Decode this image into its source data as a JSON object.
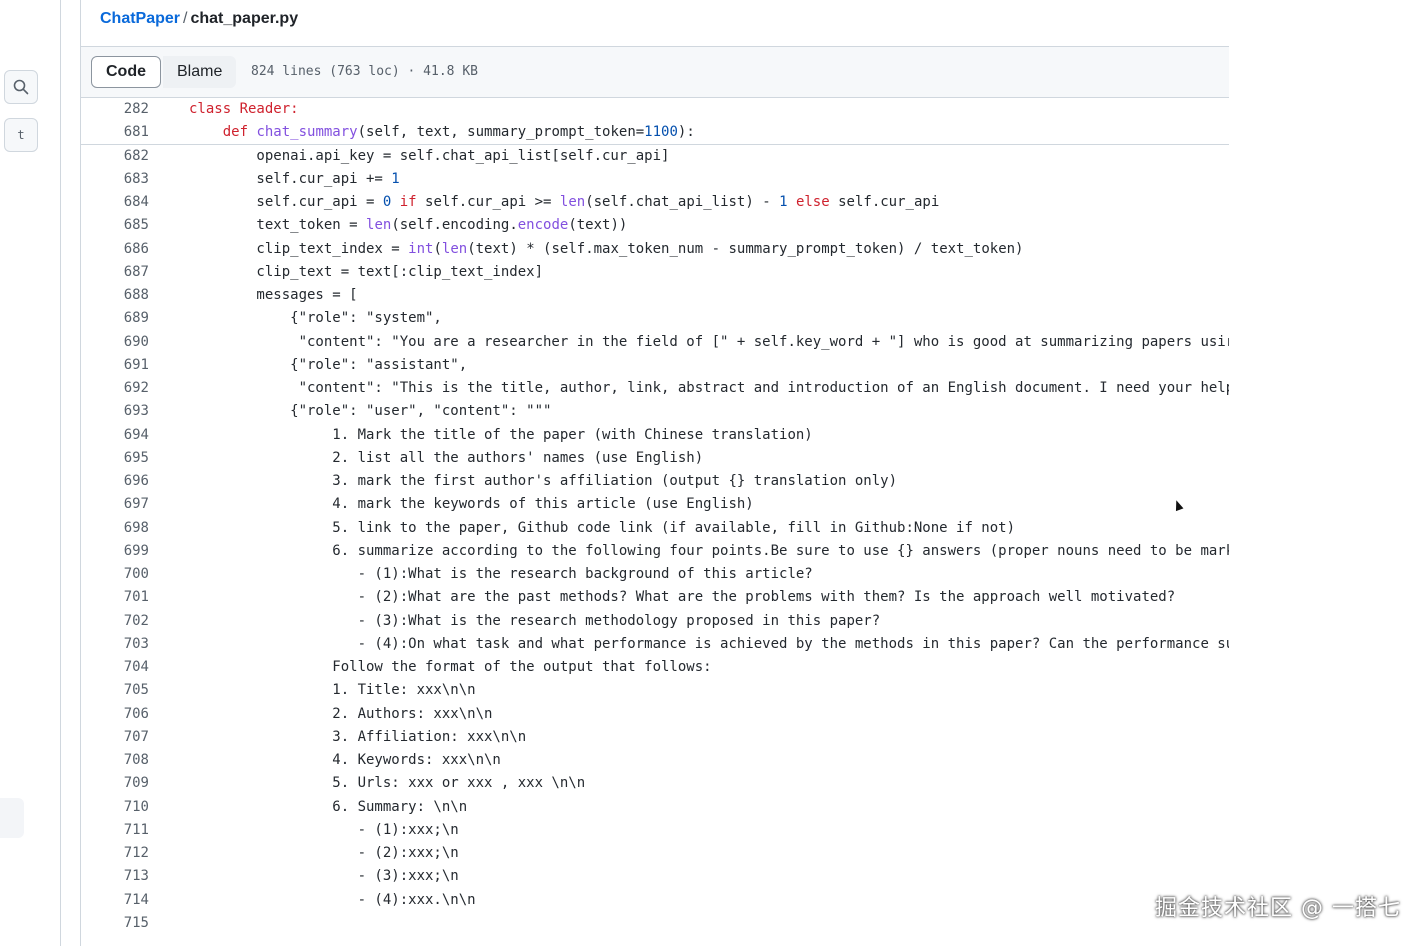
{
  "rail": {
    "search_icon": "search-icon",
    "t_button_label": "t"
  },
  "breadcrumb": {
    "repo": "ChatPaper",
    "separator": "/",
    "file": "chat_paper.py"
  },
  "tabs": {
    "code": "Code",
    "blame": "Blame"
  },
  "file_meta": "824 lines (763 loc) · 41.8 KB",
  "lines": [
    {
      "n": "282",
      "segments": [
        {
          "t": "class Reader:",
          "c": "kw"
        }
      ]
    },
    {
      "n": "681",
      "segments": [
        {
          "t": "    "
        },
        {
          "t": "def ",
          "c": "kw"
        },
        {
          "t": "chat_summary",
          "c": "fn"
        },
        {
          "t": "(self, text, summary_prompt_token="
        },
        {
          "t": "1100",
          "c": "num"
        },
        {
          "t": "):"
        }
      ]
    },
    {
      "n": "682",
      "segments": [
        {
          "t": "        openai.api_key = self.chat_api_list[self.cur_api]"
        }
      ]
    },
    {
      "n": "683",
      "segments": [
        {
          "t": "        self.cur_api += "
        },
        {
          "t": "1",
          "c": "num"
        }
      ]
    },
    {
      "n": "684",
      "segments": [
        {
          "t": "        self.cur_api = "
        },
        {
          "t": "0",
          "c": "num"
        },
        {
          "t": " "
        },
        {
          "t": "if",
          "c": "kw"
        },
        {
          "t": " self.cur_api >= "
        },
        {
          "t": "len",
          "c": "fn"
        },
        {
          "t": "(self.chat_api_list) - "
        },
        {
          "t": "1",
          "c": "num"
        },
        {
          "t": " "
        },
        {
          "t": "else",
          "c": "kw"
        },
        {
          "t": " self.cur_api"
        }
      ]
    },
    {
      "n": "685",
      "segments": [
        {
          "t": "        text_token = "
        },
        {
          "t": "len",
          "c": "fn"
        },
        {
          "t": "(self.encoding."
        },
        {
          "t": "encode",
          "c": "fn"
        },
        {
          "t": "(text))"
        }
      ]
    },
    {
      "n": "686",
      "segments": [
        {
          "t": "        clip_text_index = "
        },
        {
          "t": "int",
          "c": "fn"
        },
        {
          "t": "("
        },
        {
          "t": "len",
          "c": "fn"
        },
        {
          "t": "(text) * (self.max_token_num - summary_prompt_token) / text_token)"
        }
      ]
    },
    {
      "n": "687",
      "segments": [
        {
          "t": "        clip_text = text[:clip_text_index]"
        }
      ]
    },
    {
      "n": "688",
      "segments": [
        {
          "t": "        messages = ["
        }
      ]
    },
    {
      "n": "689",
      "segments": [
        {
          "t": "            {\"role\": \"system\","
        }
      ]
    },
    {
      "n": "690",
      "segments": [
        {
          "t": "             \"content\": \"You are a researcher in the field of [\" + self.key_word + \"] who is good at summarizing papers usir"
        }
      ]
    },
    {
      "n": "691",
      "segments": [
        {
          "t": "            {\"role\": \"assistant\","
        }
      ]
    },
    {
      "n": "692",
      "segments": [
        {
          "t": "             \"content\": \"This is the title, author, link, abstract and introduction of an English document. I need your help"
        }
      ]
    },
    {
      "n": "693",
      "segments": [
        {
          "t": "            {\"role\": \"user\", \"content\": \"\"\""
        }
      ]
    },
    {
      "n": "694",
      "segments": [
        {
          "t": "                 1. Mark the title of the paper (with Chinese translation)"
        }
      ]
    },
    {
      "n": "695",
      "segments": [
        {
          "t": "                 2. list all the authors' names (use English)"
        }
      ]
    },
    {
      "n": "696",
      "segments": [
        {
          "t": "                 3. mark the first author's affiliation (output {} translation only)"
        }
      ]
    },
    {
      "n": "697",
      "segments": [
        {
          "t": "                 4. mark the keywords of this article (use English)"
        }
      ]
    },
    {
      "n": "698",
      "segments": [
        {
          "t": "                 5. link to the paper, Github code link (if available, fill in Github:None if not)"
        }
      ]
    },
    {
      "n": "699",
      "segments": [
        {
          "t": "                 6. summarize according to the following four points.Be sure to use {} answers (proper nouns need to be mark"
        }
      ]
    },
    {
      "n": "700",
      "segments": [
        {
          "t": "                    - (1):What is the research background of this article?"
        }
      ]
    },
    {
      "n": "701",
      "segments": [
        {
          "t": "                    - (2):What are the past methods? What are the problems with them? Is the approach well motivated?"
        }
      ]
    },
    {
      "n": "702",
      "segments": [
        {
          "t": "                    - (3):What is the research methodology proposed in this paper?"
        }
      ]
    },
    {
      "n": "703",
      "segments": [
        {
          "t": "                    - (4):On what task and what performance is achieved by the methods in this paper? Can the performance su"
        }
      ]
    },
    {
      "n": "704",
      "segments": [
        {
          "t": "                 Follow the format of the output that follows:"
        }
      ]
    },
    {
      "n": "705",
      "segments": [
        {
          "t": "                 1. Title: xxx\\n\\n"
        }
      ]
    },
    {
      "n": "706",
      "segments": [
        {
          "t": "                 2. Authors: xxx\\n\\n"
        }
      ]
    },
    {
      "n": "707",
      "segments": [
        {
          "t": "                 3. Affiliation: xxx\\n\\n"
        }
      ]
    },
    {
      "n": "708",
      "segments": [
        {
          "t": "                 4. Keywords: xxx\\n\\n"
        }
      ]
    },
    {
      "n": "709",
      "segments": [
        {
          "t": "                 5. Urls: xxx or xxx , xxx \\n\\n"
        }
      ]
    },
    {
      "n": "710",
      "segments": [
        {
          "t": "                 6. Summary: \\n\\n"
        }
      ]
    },
    {
      "n": "711",
      "segments": [
        {
          "t": "                    - (1):xxx;\\n"
        }
      ]
    },
    {
      "n": "712",
      "segments": [
        {
          "t": "                    - (2):xxx;\\n"
        }
      ]
    },
    {
      "n": "713",
      "segments": [
        {
          "t": "                    - (3):xxx;\\n"
        }
      ]
    },
    {
      "n": "714",
      "segments": [
        {
          "t": "                    - (4):xxx.\\n\\n"
        }
      ]
    },
    {
      "n": "715",
      "segments": [
        {
          "t": ""
        }
      ]
    }
  ],
  "watermark": "掘金技术社区 @ 一搭七"
}
